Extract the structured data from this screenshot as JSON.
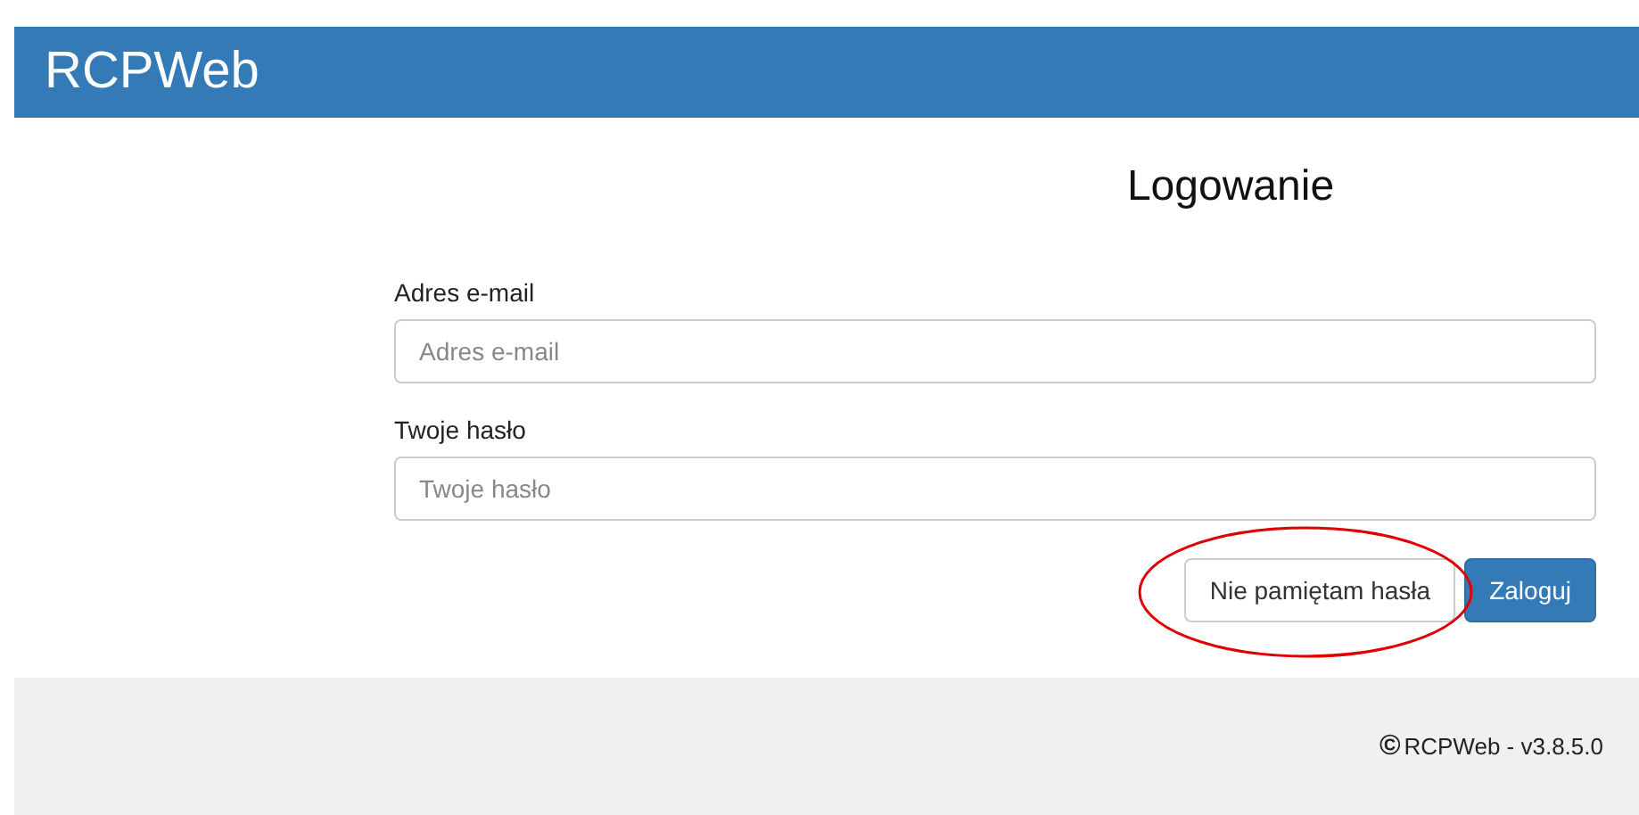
{
  "header": {
    "brand": "RCPWeb"
  },
  "login": {
    "title": "Logowanie",
    "fields": [
      {
        "label": "Adres e-mail",
        "placeholder": "Adres e-mail"
      },
      {
        "label": "Twoje hasło",
        "placeholder": "Twoje hasło"
      }
    ],
    "buttons": [
      {
        "label": "Nie pamiętam hasła",
        "kind": "default",
        "highlighted": true
      },
      {
        "label": "Zaloguj",
        "kind": "primary",
        "highlighted": false
      }
    ]
  },
  "footer": {
    "symbol": "©",
    "text": "RCPWeb - v3.8.5.0"
  }
}
